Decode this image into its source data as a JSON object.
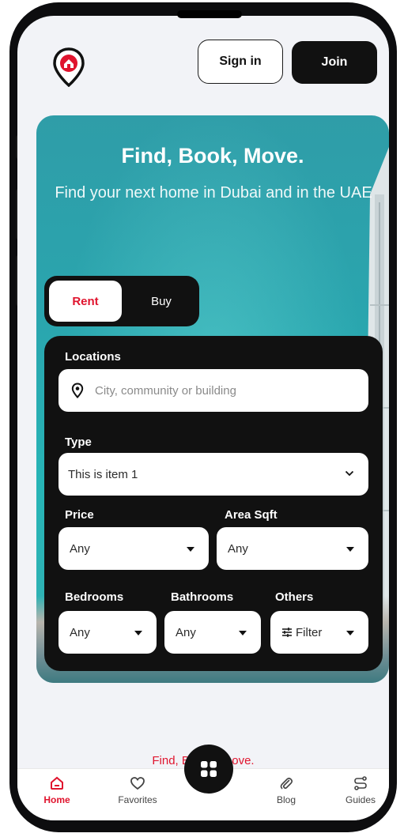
{
  "header": {
    "signin_label": "Sign in",
    "join_label": "Join"
  },
  "hero": {
    "title": "Find, Book, Move.",
    "subtitle": "Find your next home in Dubai and in the UAE"
  },
  "toggle": {
    "rent_label": "Rent",
    "buy_label": "Buy",
    "selected": "Rent"
  },
  "search": {
    "locations_label": "Locations",
    "locations_placeholder": "City, community or building",
    "type_label": "Type",
    "type_value": "This is item 1",
    "price_label": "Price",
    "price_value": "Any",
    "area_label": "Area Sqft",
    "area_value": "Any",
    "bedrooms_label": "Bedrooms",
    "bedrooms_value": "Any",
    "bathrooms_label": "Bathrooms",
    "bathrooms_value": "Any",
    "others_label": "Others",
    "filter_label": "Filter"
  },
  "footer_text": "Find, Book, Moove.",
  "tabbar": {
    "home": "Home",
    "favorites": "Favorites",
    "blog": "Blog",
    "guides": "Guides"
  },
  "colors": {
    "accent": "#e0142e",
    "dark": "#111111",
    "hero_teal": "#2aa5ae",
    "screen_bg": "#f2f3f7"
  },
  "icons": [
    "logo-pin-icon",
    "location-pin-icon",
    "chevron-down-icon",
    "filter-sliders-icon",
    "home-icon",
    "heart-icon",
    "grid-icon",
    "paperclip-icon",
    "route-icon"
  ]
}
